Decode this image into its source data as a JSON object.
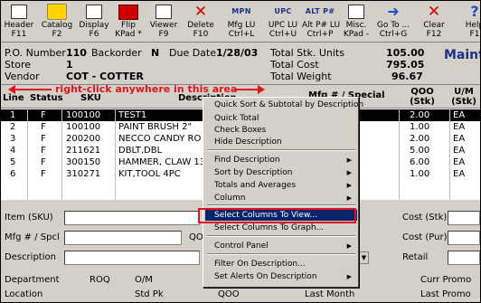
{
  "toolbar": {
    "buttons": [
      {
        "l1": "Header",
        "l2": "F11",
        "icon": "header-icon"
      },
      {
        "l1": "Catalog",
        "l2": "F2",
        "icon": "catalog-icon"
      },
      {
        "l1": "Display",
        "l2": "F6",
        "icon": "display-icon"
      },
      {
        "l1": "Flip",
        "l2": "KPad *",
        "icon": "flip-icon"
      },
      {
        "l1": "Viewer",
        "l2": "F9",
        "icon": "viewer-icon"
      },
      {
        "l1": "Delete",
        "l2": "F10",
        "icon": "delete-icon"
      },
      {
        "l1": "Mfg LU",
        "l2": "Ctrl+L",
        "icon": "mpn-icon",
        "icon_text": "MPN"
      },
      {
        "l1": "UPC LU",
        "l2": "Ctrl+U",
        "icon": "upc-icon",
        "icon_text": "UPC"
      },
      {
        "l1": "Alt P# LU",
        "l2": "Ctrl+P",
        "icon": "altpart-icon",
        "icon_text": "ALT P#"
      },
      {
        "l1": "Misc.",
        "l2": "KPad -",
        "icon": "misc-icon"
      },
      {
        "l1": "Go To ...",
        "l2": "Ctrl+G",
        "icon": "goto-icon"
      },
      {
        "l1": "Clear",
        "l2": "F12",
        "icon": "clear-icon"
      },
      {
        "l1": "Help",
        "l2": "F1",
        "icon": "help-icon"
      }
    ]
  },
  "info": {
    "po_label": "P.O. Number",
    "po_value": "110",
    "backorder_label": "Backorder",
    "backorder_value": "N",
    "due_label": "Due Date",
    "due_value": "1/28/03",
    "store_label": "Store",
    "store_value": "1",
    "vendor_label": "Vendor",
    "vendor_value": "COT  -  COTTER",
    "total_units_label": "Total Stk. Units",
    "total_units_value": "105.00",
    "total_cost_label": "Total Cost",
    "total_cost_value": "795.05",
    "total_weight_label": "Total Weight",
    "total_weight_value": "96.67",
    "screen_title": "Maint"
  },
  "hint": "right-click anywhere in this area",
  "grid": {
    "headers": {
      "line": "Line",
      "status": "Status",
      "sku": "SKU",
      "desc": "Description",
      "mfg": "Mfg # / Special",
      "qoo": "QOO",
      "qoo2": "(Stk)",
      "um": "U/M",
      "um2": "(Stk)"
    },
    "rows": [
      {
        "line": "1",
        "status": "F",
        "sku": "100100",
        "desc": "TEST1",
        "qoo": "2.00",
        "um": "EA"
      },
      {
        "line": "2",
        "status": "F",
        "sku": "100100",
        "desc": "PAINT BRUSH 2\"",
        "qoo": "1.00",
        "um": "EA"
      },
      {
        "line": "3",
        "status": "F",
        "sku": "200200",
        "desc": "NECCO CANDY RO",
        "qoo": "2.00",
        "um": "EA"
      },
      {
        "line": "4",
        "status": "F",
        "sku": "211621",
        "desc": "DBLT,DBL",
        "qoo": "5.00",
        "um": "EA"
      },
      {
        "line": "5",
        "status": "F",
        "sku": "300150",
        "desc": "HAMMER, CLAW 13",
        "qoo": "6.00",
        "um": "EA"
      },
      {
        "line": "6",
        "status": "F",
        "sku": "310271",
        "desc": "KIT,TOOL 4PC",
        "qoo": "1.00",
        "um": "EA"
      }
    ]
  },
  "form": {
    "item_label": "Item (SKU)",
    "mfg_label": "Mfg # / Spcl",
    "desc_label": "Description",
    "cost_stk_label": "Cost (Stk)",
    "cost_pur_label": "Cost (Pur)",
    "retail_label": "Retail",
    "qo_label": "QO",
    "department": "Department",
    "roq": "ROQ",
    "om": "O/M",
    "curr_promo": "Curr Promo",
    "location": "Location",
    "std_pk": "Std Pk",
    "qoo": "QOO",
    "last_month": "Last Month",
    "last_promo": "Last Promo"
  },
  "menu": {
    "items": [
      {
        "label": "Quick Sort & Subtotal by Description",
        "sub": false
      },
      {
        "label": "Quick Total",
        "sub": false
      },
      {
        "label": "Check Boxes",
        "sub": false
      },
      {
        "label": "Hide Description",
        "sub": false
      },
      {
        "label": "Find Description",
        "sub": true
      },
      {
        "label": "Sort by Description",
        "sub": true
      },
      {
        "label": "Totals and Averages",
        "sub": true
      },
      {
        "label": "Column",
        "sub": true
      },
      {
        "label": "Select Columns To View...",
        "sub": false
      },
      {
        "label": "Select Columns To Graph...",
        "sub": false
      },
      {
        "label": "Control Panel",
        "sub": true
      },
      {
        "label": "Filter On Description...",
        "sub": false
      },
      {
        "label": "Set Alerts On Description",
        "sub": true
      }
    ]
  },
  "colors": {
    "highlight": "#0a246a",
    "annotation": "#e0141e",
    "title": "#1c2f8a"
  }
}
